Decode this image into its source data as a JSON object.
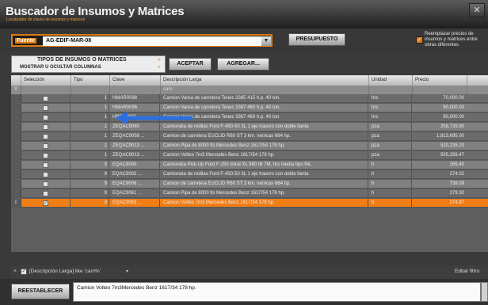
{
  "window": {
    "title": "Buscador de Insumos y Matrices",
    "subtitle": "Localizador de claves de insumos y matrices",
    "close_glyph": "✕"
  },
  "toolbar": {
    "fuente_label": "Fuente",
    "fuente_value": "AG-EDIF-MAR-08",
    "dropdown_glyph": "▼",
    "presupuesto_label": "PRESUPUESTO",
    "reemplazar_text": "Reemplazar precios de insumos y matrices entre obras diferentes",
    "reemplazar_checked": true
  },
  "tipos_panel": {
    "line1": "TIPOS DE INSUMOS O MATRICES",
    "line2": "MOSTRAR U OCULTAR COLUMNAS",
    "icon_glyph": "»"
  },
  "buttons": {
    "aceptar": "ACEPTAR",
    "agregar": "AGREGAR...",
    "reestablecer": "REESTABLECER"
  },
  "grid": {
    "columns": {
      "seleccion": "Selección",
      "tipo": "Tipo",
      "clave": "Clave",
      "descripcion": "Descripción Larga",
      "unidad": "Unidad",
      "precio": "Precio"
    },
    "filter": {
      "gutter_glyph": "∇",
      "descripcion": "cam"
    },
    "rows": [
      {
        "gutter": "",
        "check": "",
        "tipo": "1",
        "clave": "HMAR0098",
        "desc": "Camion Varea de carretera Tenec 3385 415 h.p. 40 ton.",
        "unidad": "hrs",
        "precio": "70,000.00"
      },
      {
        "gutter": "",
        "check": "",
        "tipo": "1",
        "clave": "HMAR0096",
        "desc": "Camion Varea de carretera Tenec 3387 460 h.p. 40 ton.",
        "unidad": "hrs",
        "precio": "90,000.00"
      },
      {
        "gutter": "",
        "check": "",
        "tipo": "1",
        "clave": "HRBP0085",
        "desc": "Camion Varea de carretera Tenec 3387 460 h.p. 40 ton.",
        "unidad": "hrs",
        "precio": "90,000.00"
      },
      {
        "gutter": "",
        "check": "",
        "tipo": "1",
        "clave": "ZEQAC9060",
        "desc": "Camioneta de redilas Ford F-450-50 3L 1 eje trasero con doble llanta",
        "unidad": "pza",
        "precio": "258,739.80"
      },
      {
        "gutter": "",
        "check": "",
        "tipo": "1",
        "clave": "ZEQAC9058 ...",
        "desc": "Camion de carretera EUCLID R60 ST 3 km. netricas 664 hp.",
        "unidad": "pza",
        "precio": "1,813,695.00"
      },
      {
        "gutter": "",
        "check": "",
        "tipo": "1",
        "clave": "ZEQAC9013 ...",
        "desc": "Camion Pipa de 8000 lts Mercedes Benz 1617/54 178 hp.",
        "unidad": "pza",
        "precio": "520,235.20"
      },
      {
        "gutter": "",
        "check": "",
        "tipo": "1",
        "clave": "ZEQAC9013 ...",
        "desc": "Camion Volteo 7m3 Mercedes Benz 1617/54 178 hp.",
        "unidad": "pza",
        "precio": "505,256.47"
      },
      {
        "gutter": "",
        "check": "",
        "tipo": "9",
        "clave": "EQAC9000",
        "desc": "Camioneta Pick Up Ford F-250 doral XL 980 IB 7M, hrs media tipo Nil...",
        "unidad": "h",
        "precio": "265.40"
      },
      {
        "gutter": "",
        "check": "",
        "tipo": "9",
        "clave": "EQAC9002 ...",
        "desc": "Camioneta de redilas Ford F-450-50 3L 1 eje trasero con doble llanta",
        "unidad": "h",
        "precio": "274.02"
      },
      {
        "gutter": "",
        "check": "",
        "tipo": "9",
        "clave": "EQAC9006 ...",
        "desc": "Camion de carretera EUCLID R60 ST 3 km. netricas 664 hp.",
        "unidad": "h",
        "precio": "738.09"
      },
      {
        "gutter": "",
        "check": "",
        "tipo": "9",
        "clave": "EQAC9061 ...",
        "desc": "Camion Pipa de 8000 lts Mercedes Benz 1617/54 178 hp.",
        "unidad": "h",
        "precio": "279.30"
      },
      {
        "gutter": "I",
        "check": "✓",
        "tipo": "9",
        "clave": "EQAC9063 ...",
        "desc": "Camion Volteo 7m3 Mercedes Benz 1617/34 178 hp.",
        "unidad": "h",
        "precio": "274.87"
      }
    ]
  },
  "filter_bar": {
    "close_glyph": "×",
    "check_glyph": "✓",
    "text": "[Descripción Larga] like 'cam%'",
    "caret": "▾",
    "editar": "Editar filtro"
  },
  "description_box": {
    "text": "Camion Volteo 7m3Mercedes Benz 1617/34 178 hp."
  },
  "colors": {
    "accent": "#f07e16",
    "row_dark": "#6b6b6b",
    "row_light": "#808080",
    "arrow": "#2e6fe0"
  }
}
